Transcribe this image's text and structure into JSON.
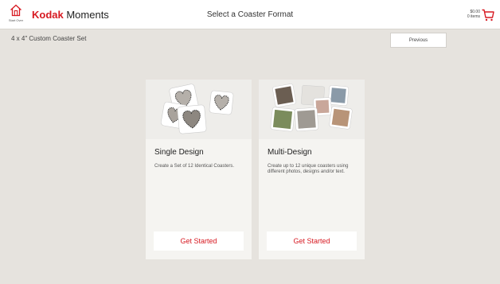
{
  "header": {
    "home_label": "Start Over",
    "brand_strong": "Kodak",
    "brand_rest": " Moments",
    "title": "Select a Coaster Format",
    "cart_amount": "$0.00",
    "cart_items": "0 items",
    "home_icon": "home-icon",
    "cart_icon": "cart-icon"
  },
  "toolbar": {
    "subtitle": "4 x 4\" Custom Coaster Set",
    "previous_label": "Previous"
  },
  "cards": [
    {
      "title": "Single Design",
      "description": "Create a Set of 12 Identical Coasters.",
      "button": "Get Started"
    },
    {
      "title": "Multi-Design",
      "description": "Create up to 12 unique coasters using different photos, designs and/or text.",
      "button": "Get Started"
    }
  ],
  "colors": {
    "accent": "#d71921",
    "background": "#e6e3de",
    "card": "#f5f4f1"
  }
}
